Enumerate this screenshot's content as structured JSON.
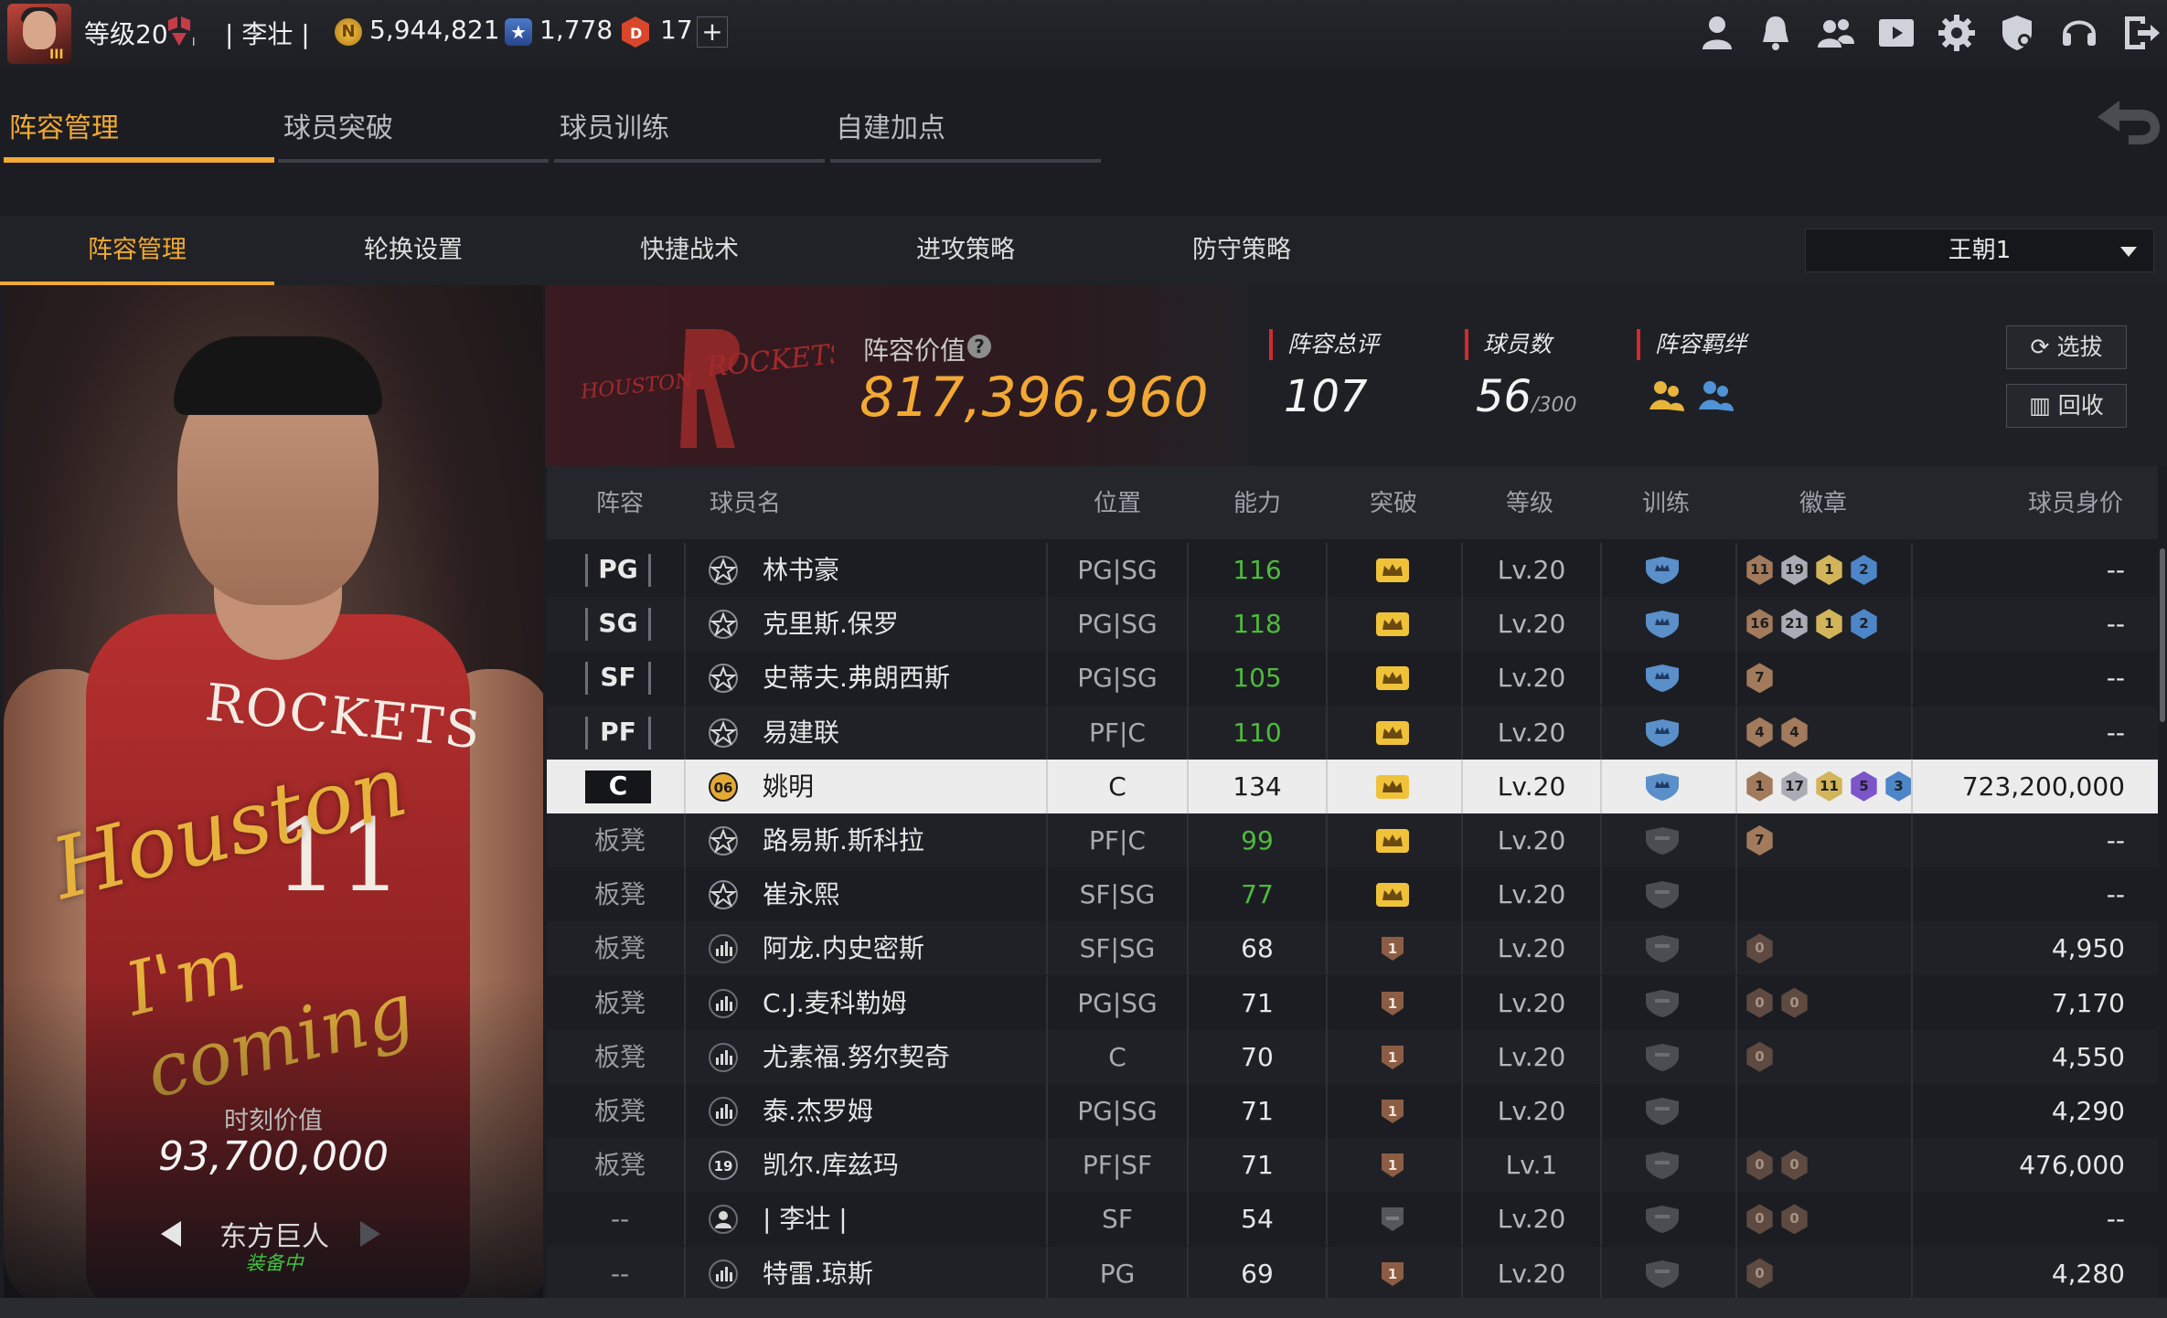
{
  "topbar": {
    "level": "等级20",
    "player_name": "| 李壮 |",
    "coins": "5,944,821",
    "stars": "1,778",
    "tickets": "17",
    "add": "+"
  },
  "main_tabs": [
    {
      "label": "阵容管理",
      "active": true
    },
    {
      "label": "球员突破",
      "active": false
    },
    {
      "label": "球员训练",
      "active": false
    },
    {
      "label": "自建加点",
      "active": false
    }
  ],
  "sub_tabs": [
    {
      "label": "阵容管理",
      "active": true
    },
    {
      "label": "轮换设置",
      "active": false
    },
    {
      "label": "快捷战术",
      "active": false
    },
    {
      "label": "进攻策略",
      "active": false
    },
    {
      "label": "防守策略",
      "active": false
    }
  ],
  "lineup_select": "王朝1",
  "card": {
    "jersey_text": "ROCKETS",
    "jersey_number": "11",
    "value_label": "时刻价值",
    "value": "93,700,000",
    "name": "东方巨人",
    "status": "装备中"
  },
  "team": {
    "logo_left": "HOUSTON",
    "logo_right": "ROCKETS",
    "value_label": "阵容价值",
    "value": "817,396,960",
    "overall_label": "阵容总评",
    "overall": "107",
    "players_label": "球员数",
    "players": "56",
    "players_max": "/300",
    "bond_label": "阵容羁绊",
    "scout_button": "选拔",
    "recycle_button": "回收"
  },
  "table": {
    "headers": [
      "阵容",
      "球员名",
      "位置",
      "能力",
      "突破",
      "等级",
      "训练",
      "徽章",
      "球员身价"
    ],
    "rows": [
      {
        "slot": "PG",
        "rank": "star",
        "name": "林书豪",
        "pos": "PG|SG",
        "ability": "116",
        "ability_color": "#4dbb3a",
        "breakthrough": "crown",
        "level": "Lv.20",
        "training": "active",
        "badges": [
          "11",
          "19",
          "1",
          "2"
        ],
        "value": "--"
      },
      {
        "slot": "SG",
        "rank": "star",
        "name": "克里斯.保罗",
        "pos": "PG|SG",
        "ability": "118",
        "ability_color": "#4dbb3a",
        "breakthrough": "crown",
        "level": "Lv.20",
        "training": "active",
        "badges": [
          "16",
          "21",
          "1",
          "2"
        ],
        "value": "--"
      },
      {
        "slot": "SF",
        "rank": "star",
        "name": "史蒂夫.弗朗西斯",
        "pos": "PG|SG",
        "ability": "105",
        "ability_color": "#4dbb3a",
        "breakthrough": "crown",
        "level": "Lv.20",
        "training": "active",
        "badges": [
          "7"
        ],
        "value": "--"
      },
      {
        "slot": "PF",
        "rank": "star",
        "name": "易建联",
        "pos": "PF|C",
        "ability": "110",
        "ability_color": "#4dbb3a",
        "breakthrough": "crown",
        "level": "Lv.20",
        "training": "active",
        "badges": [
          "4",
          "4"
        ],
        "value": "--"
      },
      {
        "slot": "C",
        "rank": "06",
        "name": "姚明",
        "pos": "C",
        "ability": "134",
        "ability_color": "#1a1a1a",
        "breakthrough": "crown",
        "level": "Lv.20",
        "training": "active",
        "badges": [
          "1",
          "17",
          "11",
          "5",
          "3"
        ],
        "value": "723,200,000",
        "selected": true
      },
      {
        "slot": "板凳",
        "rank": "star",
        "name": "路易斯.斯科拉",
        "pos": "PF|C",
        "ability": "99",
        "ability_color": "#4dbb3a",
        "breakthrough": "crown",
        "level": "Lv.20",
        "training": "inactive",
        "badges": [
          "7"
        ],
        "value": "--"
      },
      {
        "slot": "板凳",
        "rank": "star",
        "name": "崔永熙",
        "pos": "SF|SG",
        "ability": "77",
        "ability_color": "#4dbb3a",
        "breakthrough": "crown",
        "level": "Lv.20",
        "training": "inactive",
        "badges": [],
        "value": "--"
      },
      {
        "slot": "板凳",
        "rank": "bars",
        "name": "阿龙.内史密斯",
        "pos": "SF|SG",
        "ability": "68",
        "ability_color": "#e6e6e6",
        "breakthrough": "1",
        "level": "Lv.20",
        "training": "inactive",
        "badges": [
          "0"
        ],
        "value": "4,950"
      },
      {
        "slot": "板凳",
        "rank": "bars",
        "name": "C.J.麦科勒姆",
        "pos": "PG|SG",
        "ability": "71",
        "ability_color": "#e6e6e6",
        "breakthrough": "1",
        "level": "Lv.20",
        "training": "inactive",
        "badges": [
          "0",
          "0"
        ],
        "value": "7,170"
      },
      {
        "slot": "板凳",
        "rank": "bars",
        "name": "尤素福.努尔契奇",
        "pos": "C",
        "ability": "70",
        "ability_color": "#e6e6e6",
        "breakthrough": "1",
        "level": "Lv.20",
        "training": "inactive",
        "badges": [
          "0"
        ],
        "value": "4,550"
      },
      {
        "slot": "板凳",
        "rank": "bars",
        "name": "泰.杰罗姆",
        "pos": "PG|SG",
        "ability": "71",
        "ability_color": "#e6e6e6",
        "breakthrough": "1",
        "level": "Lv.20",
        "training": "inactive",
        "badges": [],
        "value": "4,290"
      },
      {
        "slot": "板凳",
        "rank": "19",
        "name": "凯尔.库兹玛",
        "pos": "PF|SF",
        "ability": "71",
        "ability_color": "#e6e6e6",
        "breakthrough": "1",
        "level": "Lv.1",
        "training": "inactive",
        "badges": [
          "0",
          "0"
        ],
        "value": "476,000"
      },
      {
        "slot": "--",
        "rank": "person",
        "name": "| 李壮 |",
        "pos": "SF",
        "ability": "54",
        "ability_color": "#e6e6e6",
        "breakthrough": "none",
        "level": "Lv.20",
        "training": "inactive",
        "badges": [
          "0",
          "0"
        ],
        "value": "--"
      },
      {
        "slot": "--",
        "rank": "bars",
        "name": "特雷.琼斯",
        "pos": "PG",
        "ability": "69",
        "ability_color": "#e6e6e6",
        "breakthrough": "1",
        "level": "Lv.20",
        "training": "inactive",
        "badges": [
          "0"
        ],
        "value": "4,280"
      }
    ]
  },
  "colors": {
    "accent": "#f2a933",
    "green": "#4dbb3a",
    "red": "#d12b2b",
    "shield_blue": "#5a8fc9"
  }
}
